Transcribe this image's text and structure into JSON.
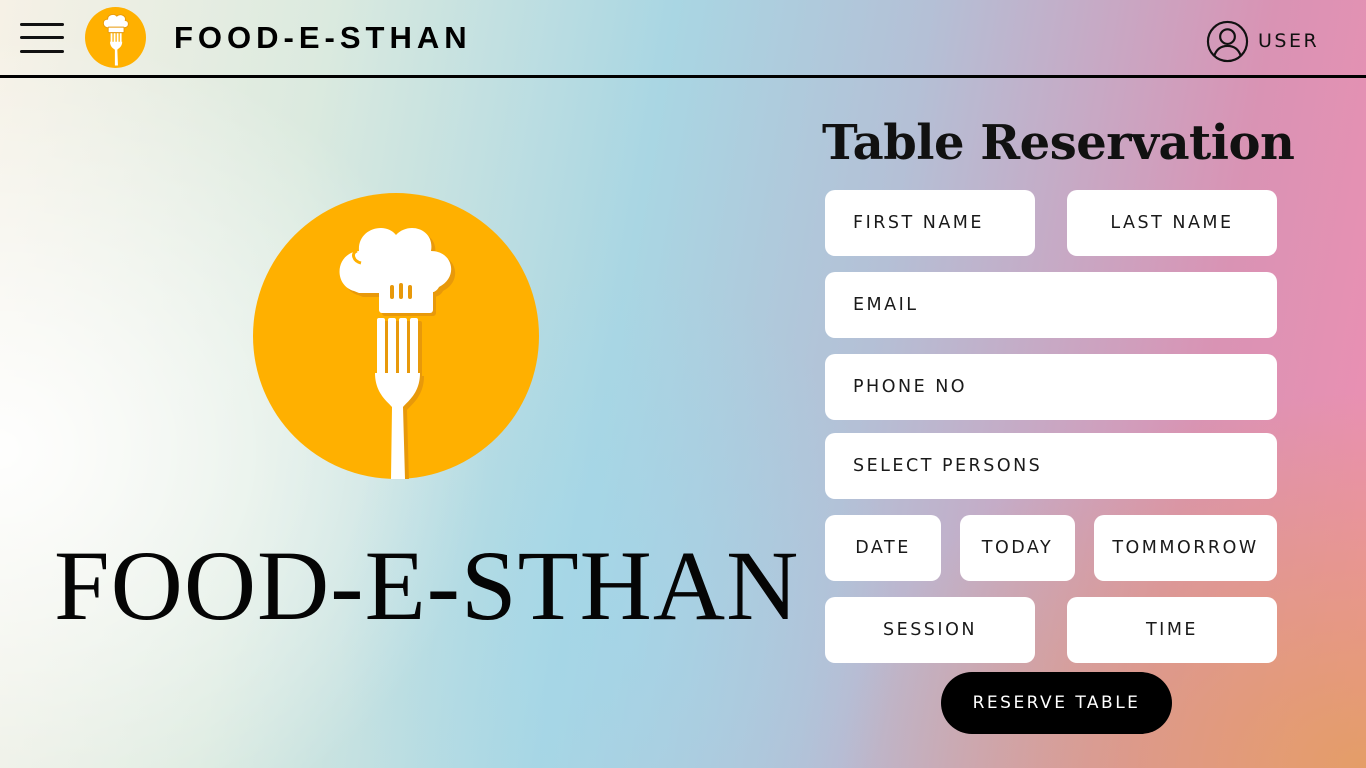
{
  "header": {
    "brand": "FOOD-E-STHAN",
    "user_label": "USER"
  },
  "hero": {
    "title": "FOOD-E-STHAN"
  },
  "colors": {
    "logo_orange": "#FFB000",
    "accent_black": "#000000"
  },
  "icons": {
    "menu": "hamburger-menu-icon",
    "logo": "chef-hat-fork-logo",
    "user": "user-circle-icon"
  },
  "form": {
    "title": "Table Reservation",
    "first_name_placeholder": "FIRST NAME",
    "last_name_placeholder": "LAST NAME",
    "email_placeholder": "EMAIL",
    "phone_placeholder": "PHONE NO",
    "persons_placeholder": "SELECT PERSONS",
    "date_label": "DATE",
    "today_label": "TODAY",
    "tomorrow_label": "TOMMORROW",
    "session_label": "SESSION",
    "time_label": "TIME",
    "reserve_button": "RESERVE TABLE"
  }
}
